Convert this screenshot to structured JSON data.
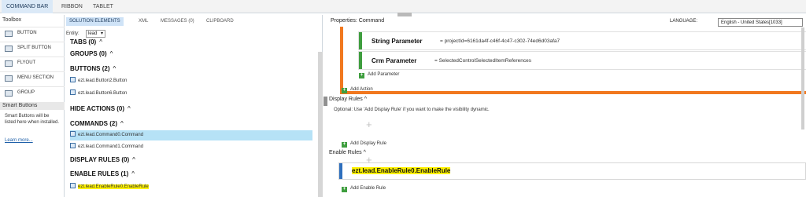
{
  "top_tabs": [
    "COMMAND BAR",
    "RIBBON",
    "TABLET"
  ],
  "toolbox": {
    "title": "Toolbox",
    "items": [
      "BUTTON",
      "SPLIT BUTTON",
      "FLYOUT",
      "MENU SECTION",
      "GROUP"
    ],
    "smart_title": "Smart Buttons",
    "smart_text": "Smart Buttons will be listed here when installed.",
    "smart_link": "Learn more..."
  },
  "middle": {
    "tabs": [
      "SOLUTION ELEMENTS",
      "XML",
      "MESSAGES (0)",
      "CLIPBOARD"
    ],
    "entity_label": "Entity:",
    "entity_value": "lead",
    "sections": {
      "tabs": "TABS (0)",
      "groups": "GROUPS (0)",
      "buttons": "BUTTONS (2)",
      "hide_actions": "HIDE ACTIONS (0)",
      "commands": "COMMANDS (2)",
      "display_rules": "DISPLAY RULES (0)",
      "enable_rules": "ENABLE RULES (1)"
    },
    "buttons": [
      "ezt.lead.Button2.Button",
      "ezt.lead.Button6.Button"
    ],
    "commands": [
      "ezt.lead.Command0.Command",
      "ezt.lead.Command1.Command"
    ],
    "enable_rules": [
      "ezt.lead.EnableRule0.EnableRule"
    ]
  },
  "properties": {
    "title": "Properties: Command",
    "language_label": "LANGUAGE:",
    "language_value": "English - United States[1033]",
    "params": [
      {
        "name": "String Parameter",
        "value": "= projectId=6161da4f-c46f-4c47-c302-74ed6d03afa7"
      },
      {
        "name": "Crm Parameter",
        "value": "= SelectedControlSelectedItemReferences"
      }
    ],
    "add_parameter": "Add Parameter",
    "add_action": "Add Action",
    "display_rules_head": "Display Rules",
    "display_rules_hint": "Optional: Use 'Add Display Rule' if you want to make the visibility dynamic.",
    "add_display_rule": "Add Display Rule",
    "enable_rules_head": "Enable Rules",
    "enable_rule_name": "ezt.lead.EnableRule0.EnableRule",
    "add_enable_rule": "Add Enable Rule"
  }
}
